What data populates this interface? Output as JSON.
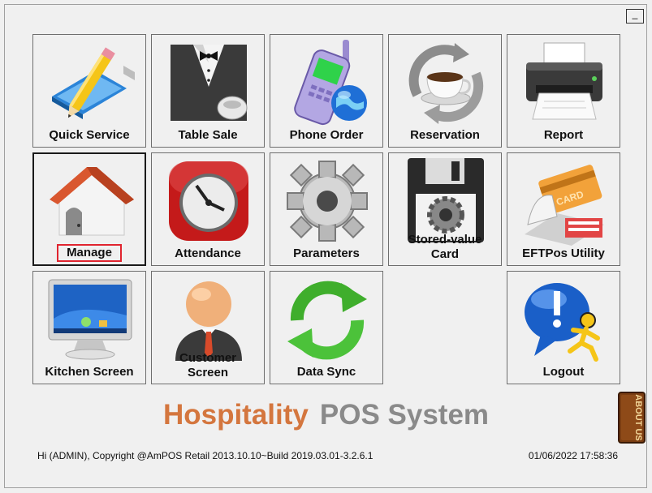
{
  "window": {
    "minimize_label": "_"
  },
  "tiles": [
    {
      "label": "Quick Service",
      "icon": "pencil-pad-icon"
    },
    {
      "label": "Table Sale",
      "icon": "waiter-tuxedo-icon"
    },
    {
      "label": "Phone Order",
      "icon": "phone-globe-icon"
    },
    {
      "label": "Reservation",
      "icon": "coffee-cycle-icon"
    },
    {
      "label": "Report",
      "icon": "printer-icon"
    },
    {
      "label": "Manage",
      "icon": "house-icon"
    },
    {
      "label": "Attendance",
      "icon": "clock-icon"
    },
    {
      "label": "Parameters",
      "icon": "gear-icon"
    },
    {
      "label_line1": "Stored-value",
      "label_line2": "Card",
      "icon": "floppy-gear-icon"
    },
    {
      "label": "EFTPos Utility",
      "icon": "card-terminal-icon"
    },
    {
      "label": "Kitchen Screen",
      "icon": "monitor-icon"
    },
    {
      "label_line1": "Customer",
      "label_line2": "Screen",
      "icon": "person-icon"
    },
    {
      "label": "Data Sync",
      "icon": "sync-arrows-icon"
    },
    {
      "label": "Logout",
      "icon": "logout-runner-icon"
    }
  ],
  "brand": {
    "word1": "Hospitality",
    "word2": "POS System"
  },
  "footer": {
    "copyright": "Hi (ADMIN), Copyright @AmPOS Retail 2013.10.10~Build 2019.03.01-3.2.6.1",
    "datetime": "01/06/2022 17:58:36"
  },
  "about_label": "ABOUT US",
  "colors": {
    "brand_orange": "#d4763e",
    "brand_gray": "#8a8a8a",
    "selection_red": "#e0242f"
  }
}
